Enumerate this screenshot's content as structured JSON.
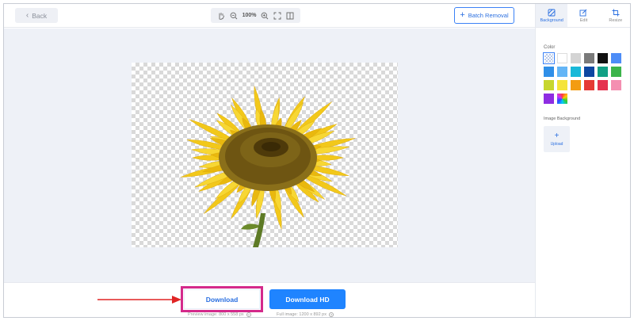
{
  "toolbar": {
    "back_label": "Back",
    "zoom_level": "100%",
    "batch_label": "Batch Removal"
  },
  "panel": {
    "tabs": [
      {
        "label": "Background",
        "icon": "background-icon",
        "active": true
      },
      {
        "label": "Edit",
        "icon": "edit-icon",
        "active": false
      },
      {
        "label": "Resize",
        "icon": "crop-icon",
        "active": false
      }
    ],
    "color_label": "Color",
    "colors": [
      "transparent",
      "#ffffff",
      "#d4d4d4",
      "#7a7a7a",
      "#111111",
      "#4d8df7",
      "#2f8fe8",
      "#64b5f6",
      "#18b8d8",
      "#0d47a1",
      "#12a085",
      "#3cb44b",
      "#c7d62e",
      "#f5e43a",
      "#f39c12",
      "#e53935",
      "#e5324f",
      "#f48fb1",
      "#8e2de2",
      "rainbow"
    ],
    "image_background_label": "Image Background",
    "upload_label": "Upload"
  },
  "bottom": {
    "download_label": "Download",
    "download_hd_label": "Download HD",
    "preview_info": "Preview image: 800 x 558 px",
    "full_info": "Full image: 1200 x 892 px"
  },
  "accent": "#1f84ff",
  "highlight": "#d42a8b"
}
